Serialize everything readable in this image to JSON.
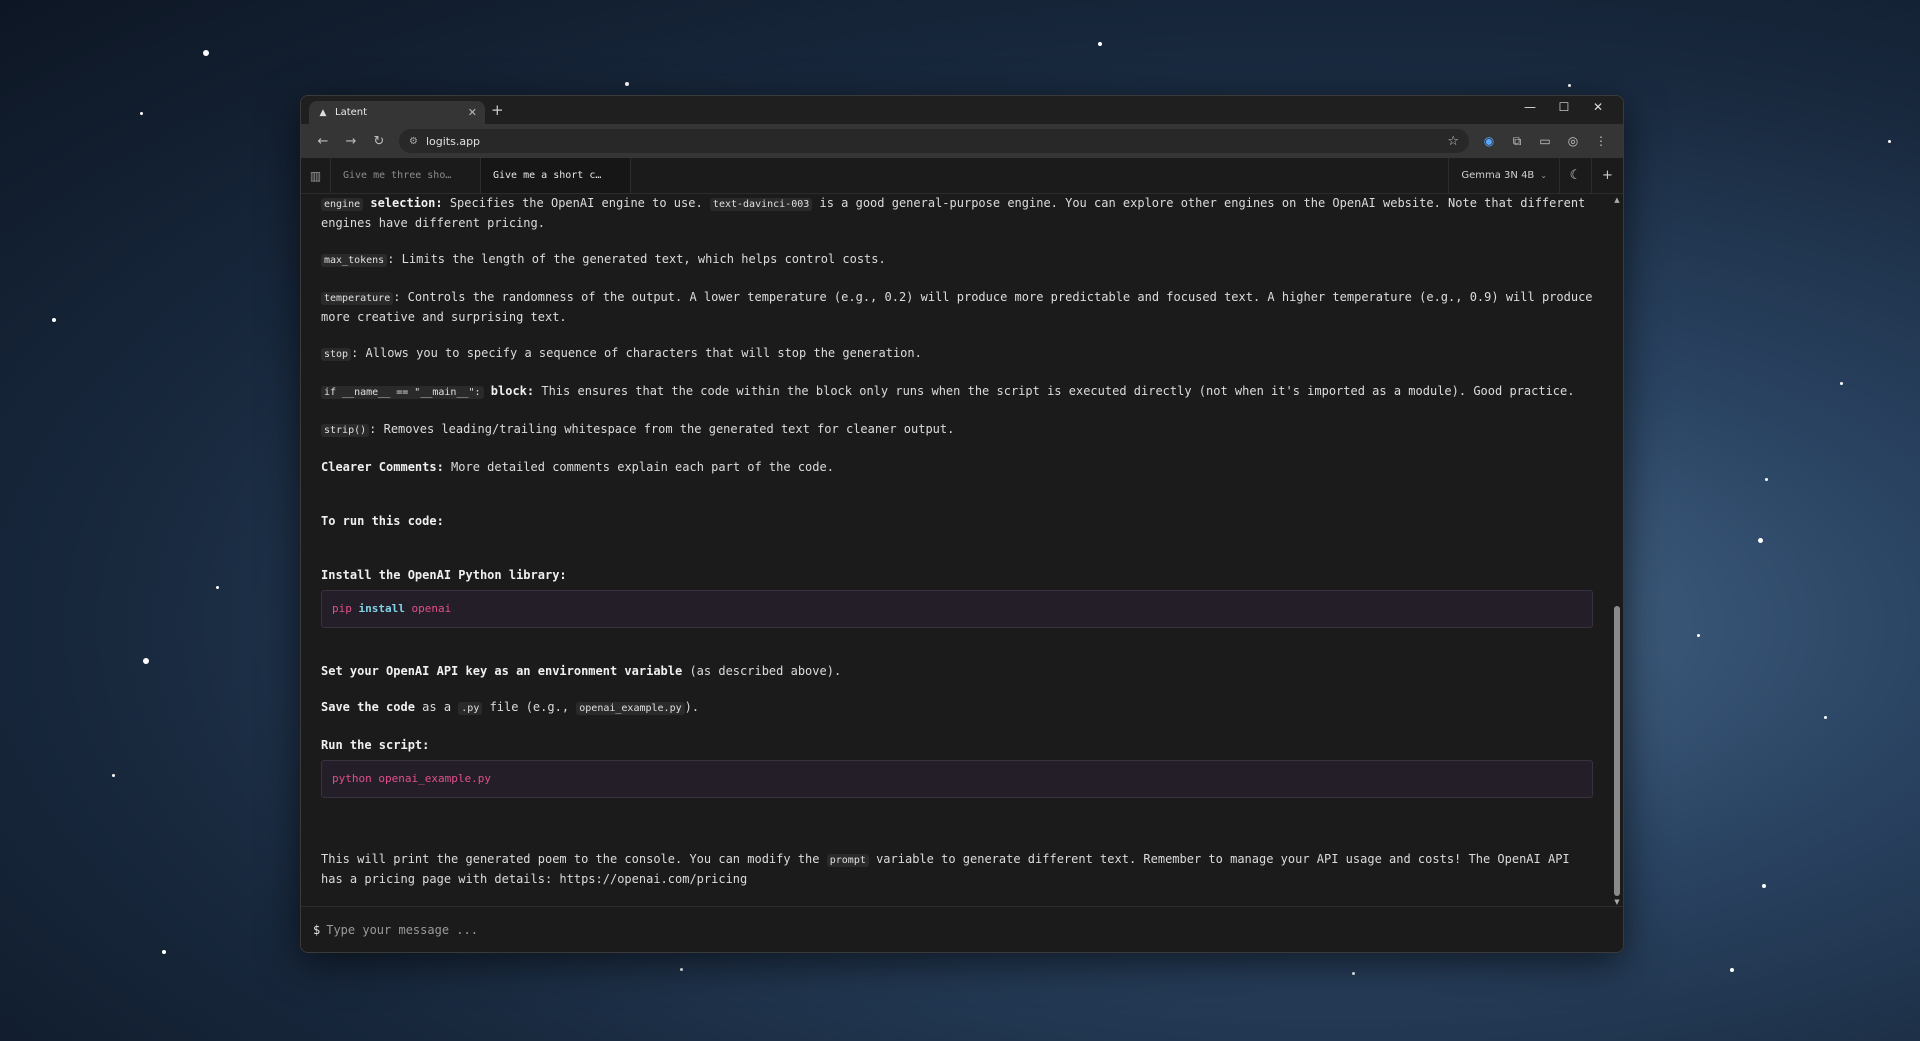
{
  "browser": {
    "tab_title": "Latent",
    "tab_close": "✕",
    "new_tab": "+",
    "url": "logits.app",
    "window_controls": [
      "—",
      "☐",
      "✕"
    ]
  },
  "app": {
    "conversation_tabs": [
      {
        "label": "Give me three sho…",
        "active": false
      },
      {
        "label": "Give me a short c…",
        "active": true
      }
    ],
    "model_selector": "Gemma 3N 4B",
    "input_prompt": "$",
    "input_placeholder": "Type your message ..."
  },
  "message": {
    "engine": {
      "code": "engine",
      "bold": "selection:",
      "text_a": " Specifies the OpenAI engine to use. ",
      "code2": "text-davinci-003",
      "text_b": " is a good general-purpose engine.  You can explore other engines on the OpenAI website.  Note that different engines have different pricing."
    },
    "max_tokens": {
      "code": "max_tokens",
      "text": ": Limits the length of the generated text, which helps control costs."
    },
    "temperature": {
      "code": "temperature",
      "text": ":  Controls the randomness of the output.  A lower temperature (e.g., 0.2) will produce more predictable and focused text.  A higher temperature (e.g., 0.9) will produce more creative and surprising text."
    },
    "stop": {
      "code": "stop",
      "text": ":  Allows you to specify a sequence of characters that will stop the generation."
    },
    "ifname": {
      "code": "if __name__ == \"__main__\":",
      "bold": " block:",
      "text": "  This ensures that the code within the block only runs when the script is executed directly (not when it's imported as a module).  Good practice."
    },
    "strip": {
      "code": "strip()",
      "text": ": Removes leading/trailing whitespace from the generated text for cleaner output."
    },
    "comments": {
      "bold": "Clearer Comments:",
      "text": "  More detailed comments explain each part of the code."
    },
    "to_run": "To run this code:",
    "install_heading": "Install the OpenAI Python library:",
    "pip_code": {
      "cmd": "pip",
      "kw": "install",
      "pkg": "openai"
    },
    "set_key": {
      "bold": "Set your OpenAI API key as an environment variable",
      "text": " (as described above)."
    },
    "save_code": {
      "bold": "Save the code",
      "text_a": " as a ",
      "code": ".py",
      "text_b": " file (e.g., ",
      "code2": "openai_example.py",
      "text_c": ")."
    },
    "run_heading": "Run the script:",
    "run_code": "python openai_example.py",
    "final": {
      "text_a": "This will print the generated poem to the console.  You can modify the ",
      "code": "prompt",
      "text_b": " variable to generate different text.  Remember to manage your API usage and costs!  The OpenAI API has a pricing page with details: https://openai.com/pricing"
    }
  }
}
